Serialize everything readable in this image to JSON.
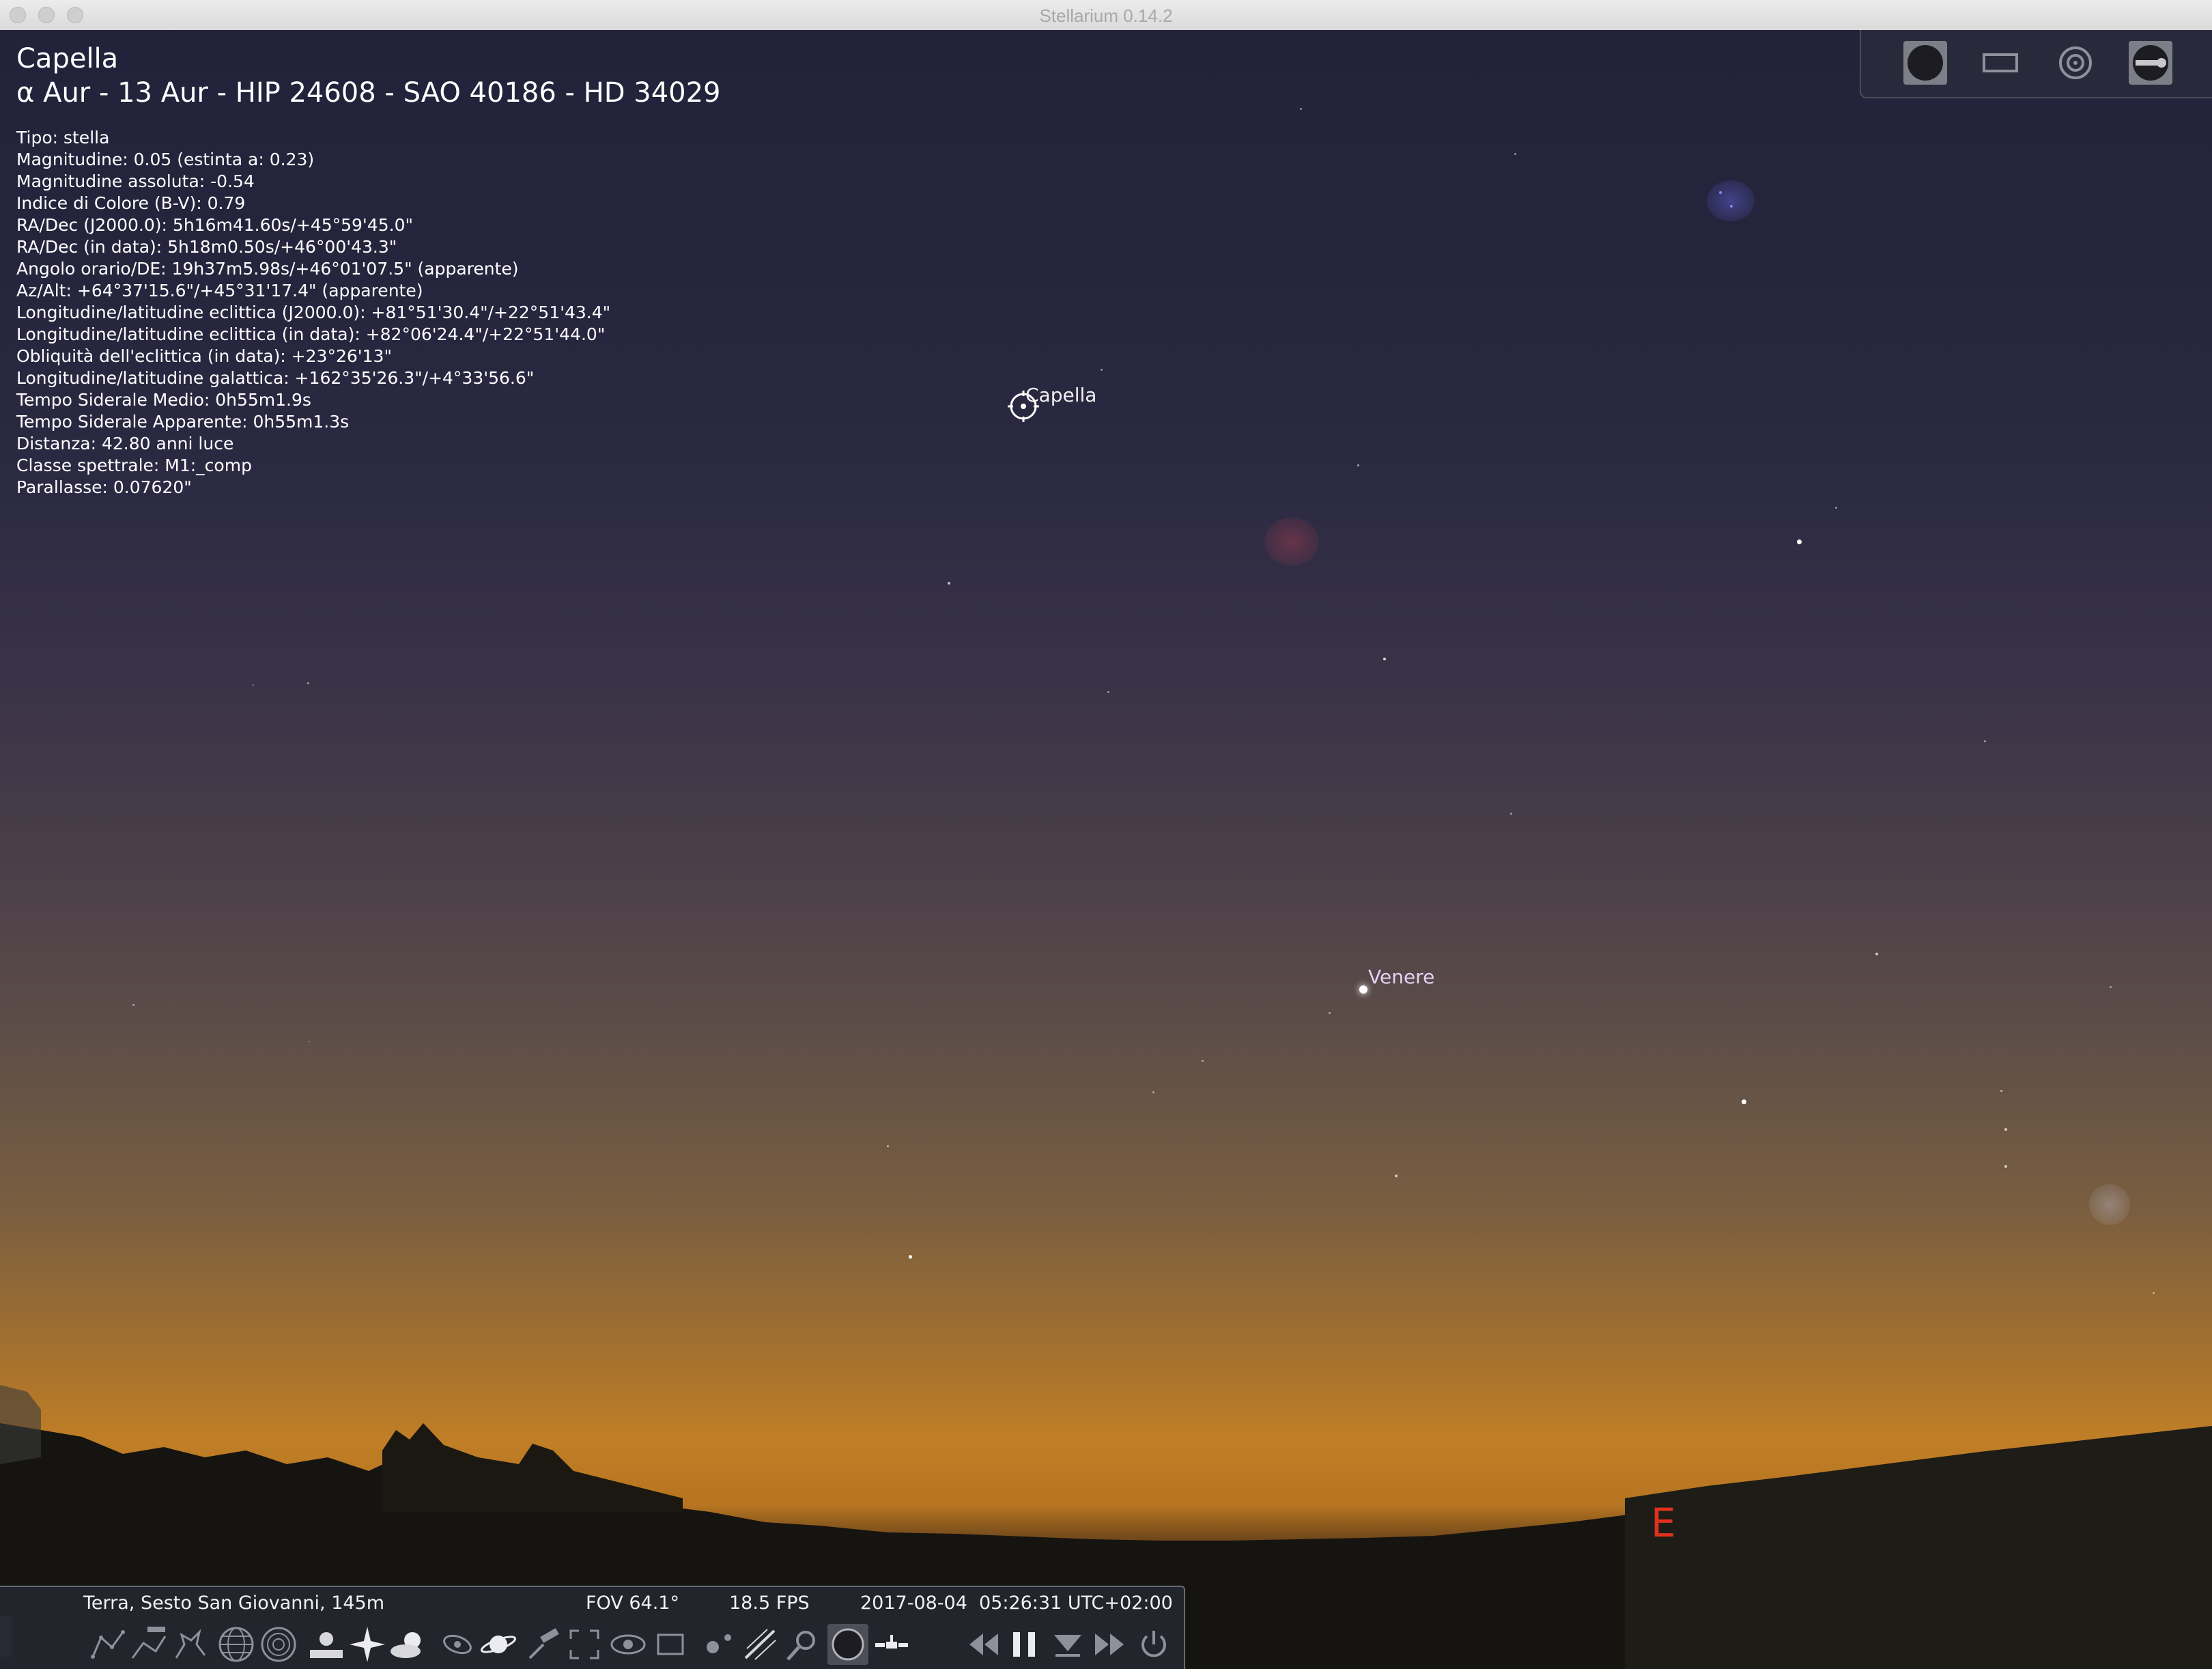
{
  "window": {
    "title": "Stellarium 0.14.2"
  },
  "selected_object": {
    "name": "Capella",
    "designations": "α Aur - 13 Aur - HIP 24608 - SAO 40186 - HD 34029",
    "lines": [
      "Tipo: stella",
      "Magnitudine: 0.05 (estinta a: 0.23)",
      "Magnitudine assoluta: -0.54",
      "Indice di Colore (B-V): 0.79",
      "RA/Dec (J2000.0): 5h16m41.60s/+45°59'45.0\"",
      "RA/Dec (in data): 5h18m0.50s/+46°00'43.3\"",
      "Angolo orario/DE: 19h37m5.98s/+46°01'07.5\" (apparente)",
      "Az/Alt: +64°37'15.6\"/+45°31'17.4\" (apparente)",
      "Longitudine/latitudine eclittica (J2000.0): +81°51'30.4\"/+22°51'43.4\"",
      "Longitudine/latitudine eclittica (in data): +82°06'24.4\"/+22°51'44.0\"",
      "Obliquità dell'eclittica (in data): +23°26'13\"",
      "Longitudine/latitudine galattica: +162°35'26.3\"/+4°33'56.6\"",
      "Tempo Siderale Medio: 0h55m1.9s",
      "Tempo Siderale Apparente: 0h55m1.3s",
      "Distanza: 42.80 anni luce",
      "Classe spettrale: M1:_comp",
      "Parallasse: 0.07620\""
    ]
  },
  "sky_labels": {
    "capella": "Capella",
    "venus": "Venere",
    "compass_east": "E"
  },
  "status": {
    "location": "Terra, Sesto San Giovanni, 145m",
    "fov": "FOV 64.1°",
    "fps": "18.5 FPS",
    "date": "2017-08-04",
    "time": "05:26:31 UTC+02:00"
  },
  "toolbar_icons": [
    "constellation-lines-icon",
    "constellation-labels-icon",
    "constellation-art-icon",
    "equatorial-grid-icon",
    "azimuthal-grid-icon",
    "ground-icon",
    "cardinal-points-icon",
    "atmosphere-icon",
    "nebulae-icon",
    "planet-labels-icon",
    "equatorial-mount-icon",
    "center-selected-icon",
    "night-mode-icon",
    "fullscreen-icon",
    "exoplanets-icon",
    "meteor-showers-icon",
    "telescope-control-icon",
    "oculars-icon",
    "satellites-icon",
    "decrease-speed-icon",
    "pause-icon",
    "current-time-icon",
    "increase-speed-icon",
    "quit-icon"
  ],
  "top_panel_icons": [
    "ocular-view-icon",
    "sensor-frame-icon",
    "telrad-icon",
    "ocular-config-icon"
  ],
  "colors": {
    "compass": "#e03020",
    "venus_label": "#e0d2f2",
    "twilight": "#c07e26"
  }
}
